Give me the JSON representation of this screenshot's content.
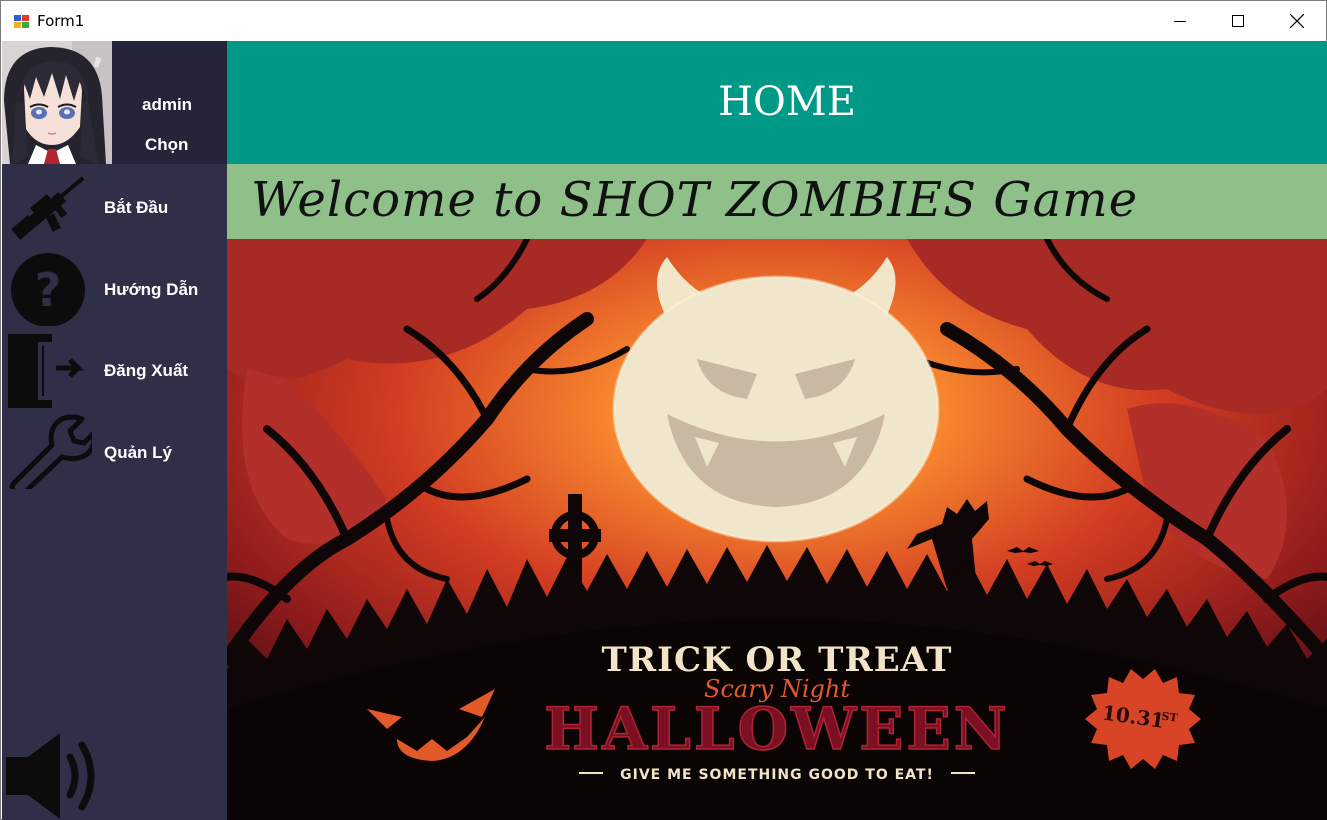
{
  "window": {
    "title": "Form1"
  },
  "sidebar": {
    "profile": {
      "username": "admin",
      "choose_label": "Chọn"
    },
    "items": [
      {
        "label": "Bắt Đầu",
        "icon": "rifle-icon"
      },
      {
        "label": "Hướng Dẫn",
        "icon": "question-circle-icon"
      },
      {
        "label": "Đăng Xuất",
        "icon": "logout-door-icon"
      },
      {
        "label": "Quản Lý",
        "icon": "wrench-icon"
      }
    ],
    "sound_icon": "speaker-icon"
  },
  "header": {
    "title": "HOME"
  },
  "welcome": {
    "text": "Welcome to SHOT ZOMBIES Game"
  },
  "banner": {
    "line1": "TRICK OR TREAT",
    "line2": "Scary Night",
    "line3": "HALLOWEEN",
    "line4": "GIVE ME SOMETHING GOOD TO EAT!",
    "date_main": "10.31",
    "date_suffix": "ST"
  },
  "colors": {
    "sidebar": "#2f2f48",
    "profile": "#25253a",
    "header": "#009887",
    "welcome": "#8fc08a",
    "halloween_red": "#7a1022",
    "orange": "#e35a2a"
  }
}
